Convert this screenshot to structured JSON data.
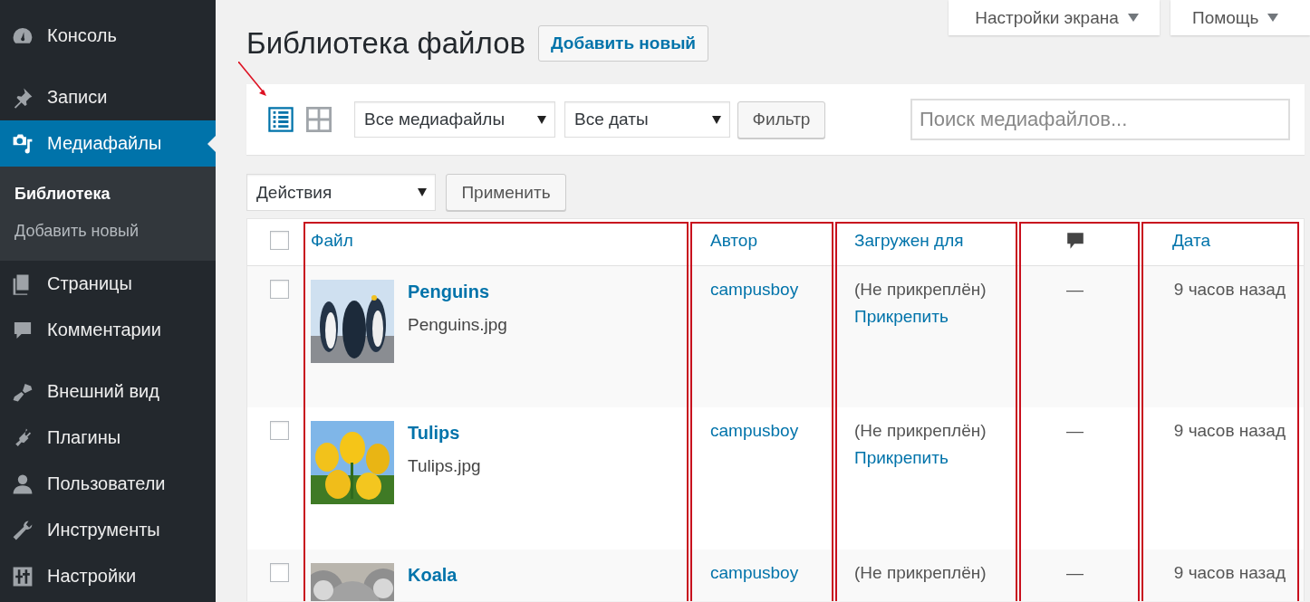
{
  "sidebar": {
    "groups": [
      [
        {
          "label": "Консоль",
          "selected": false
        }
      ],
      [
        {
          "label": "Записи",
          "selected": false
        },
        {
          "label": "Медиафайлы",
          "selected": true,
          "children": [
            {
              "label": "Библиотека",
              "selected": true
            },
            {
              "label": "Добавить новый",
              "selected": false
            }
          ]
        },
        {
          "label": "Страницы",
          "selected": false
        },
        {
          "label": "Комментарии",
          "selected": false
        }
      ],
      [
        {
          "label": "Внешний вид",
          "selected": false
        },
        {
          "label": "Плагины",
          "selected": false
        },
        {
          "label": "Пользователи",
          "selected": false
        },
        {
          "label": "Инструменты",
          "selected": false
        },
        {
          "label": "Настройки",
          "selected": false
        }
      ]
    ]
  },
  "screen_meta": [
    {
      "label": "Настройки экрана"
    },
    {
      "label": "Помощь"
    }
  ],
  "title": "Библиотека файлов",
  "add_new_button": "Добавить новый",
  "view_modes": [
    {
      "kind": "list",
      "selected": true,
      "annotated": true
    },
    {
      "kind": "grid",
      "selected": false,
      "annotated": false
    }
  ],
  "filters": [
    {
      "value": "Все медиафайлы"
    },
    {
      "value": "Все даты"
    }
  ],
  "filter_button": "Фильтр",
  "search": {
    "placeholder": "Поиск медиафайлов..."
  },
  "bulk_actions": {
    "value": "Действия"
  },
  "apply_button": "Применить",
  "table": {
    "select_all": {
      "checked": false
    },
    "columns": [
      {
        "kind": "file",
        "label": "Файл",
        "highlighted": true
      },
      {
        "kind": "author",
        "label": "Автор",
        "highlighted": true
      },
      {
        "kind": "parent",
        "label": "Загружен для",
        "highlighted": true
      },
      {
        "kind": "comments",
        "highlighted": true
      },
      {
        "kind": "date",
        "label": "Дата",
        "highlighted": true
      }
    ],
    "rows": [
      {
        "checked": false,
        "title": "Penguins",
        "filename": "Penguins.jpg",
        "author": "campusboy",
        "attached": "(Не прикреплён)",
        "attach_link": "Прикрепить",
        "comments": "—",
        "date": "9 часов назад"
      },
      {
        "checked": false,
        "title": "Tulips",
        "filename": "Tulips.jpg",
        "author": "campusboy",
        "attached": "(Не прикреплён)",
        "attach_link": "Прикрепить",
        "comments": "—",
        "date": "9 часов назад"
      },
      {
        "checked": false,
        "title": "Koala",
        "author": "campusboy",
        "attached": "(Не прикреплён)",
        "comments": "—",
        "date": "9 часов назад"
      }
    ]
  }
}
